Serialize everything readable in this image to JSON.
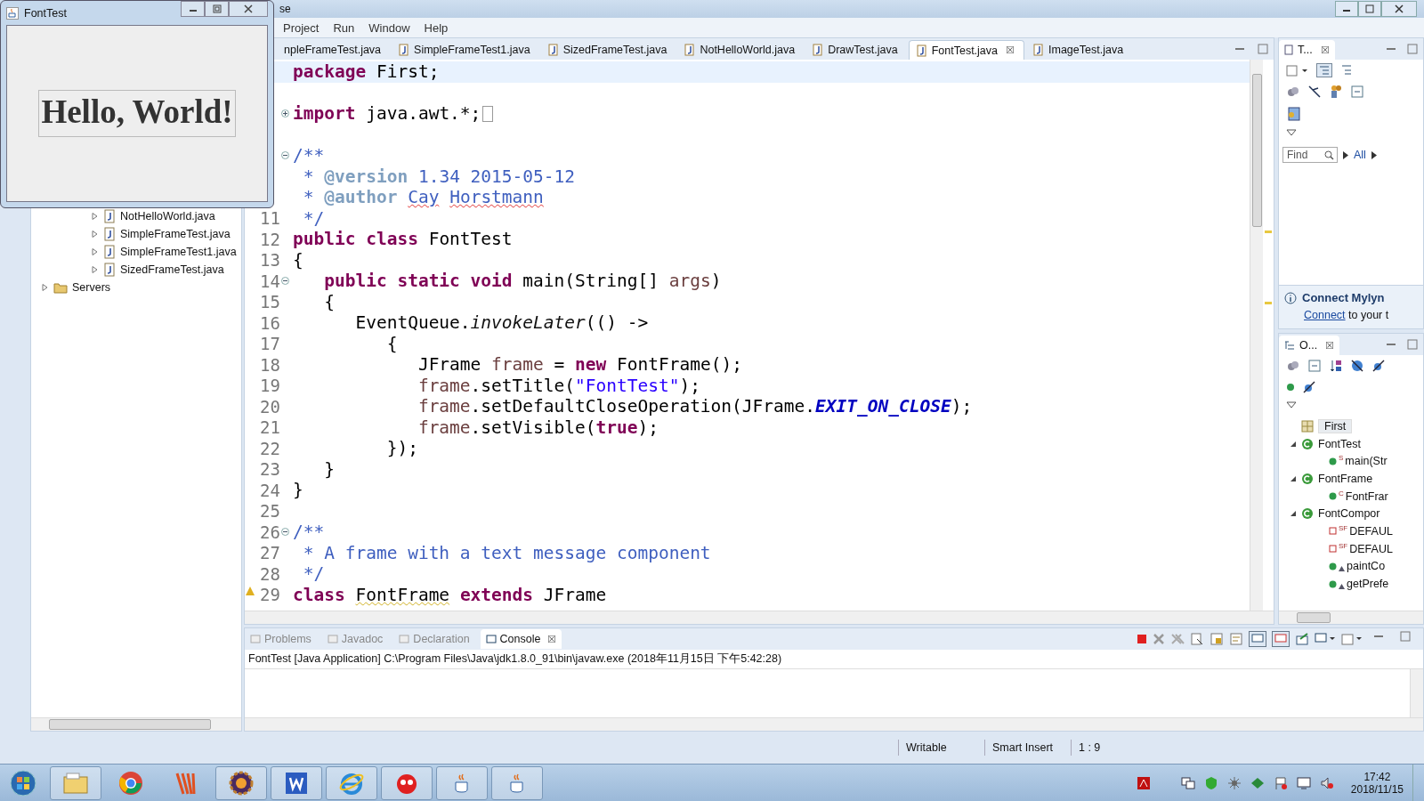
{
  "eclipse_window": {
    "title": "se"
  },
  "menu": [
    "Project",
    "Run",
    "Window",
    "Help"
  ],
  "project_explorer": {
    "items": [
      {
        "label": "NotHelloWorld.java",
        "kind": "java",
        "expanded": false
      },
      {
        "label": "SimpleFrameTest.java",
        "kind": "java",
        "expanded": false
      },
      {
        "label": "SimpleFrameTest1.java",
        "kind": "java",
        "expanded": false
      },
      {
        "label": "SizedFrameTest.java",
        "kind": "java",
        "expanded": false
      },
      {
        "label": "Servers",
        "kind": "folder",
        "expanded": false
      }
    ]
  },
  "editor": {
    "tabs": [
      {
        "label": "npleFrameTest.java",
        "selected": false
      },
      {
        "label": "SimpleFrameTest1.java",
        "selected": false
      },
      {
        "label": "SizedFrameTest.java",
        "selected": false
      },
      {
        "label": "NotHelloWorld.java",
        "selected": false
      },
      {
        "label": "DrawTest.java",
        "selected": false
      },
      {
        "label": "FontTest.java",
        "selected": true,
        "close": "☒"
      },
      {
        "label": "ImageTest.java",
        "selected": false
      }
    ],
    "lines": [
      {
        "current": true,
        "tokens": [
          {
            "kind": "kw",
            "text": "package"
          },
          {
            "kind": "plain",
            "text": " First;"
          }
        ]
      },
      {
        "current": false
      },
      {
        "current": false,
        "folded": true,
        "folded_box": true,
        "tokens": [
          {
            "kind": "kw",
            "text": "import"
          },
          {
            "kind": "plain",
            "text": " java.awt.*;"
          }
        ]
      },
      {
        "current": false
      },
      {
        "current": false,
        "folded": false,
        "tokens": [
          {
            "kind": "javadoc",
            "text": "/**"
          }
        ]
      },
      {
        "current": false,
        "tokens": [
          {
            "kind": "javadoc",
            "text": " * "
          },
          {
            "kind": "jdtag",
            "text": "@version"
          },
          {
            "kind": "javadoc",
            "text": " 1.34 2015-05-12"
          }
        ]
      },
      {
        "current": false,
        "tokens": [
          {
            "kind": "javadoc",
            "text": " * "
          },
          {
            "kind": "jdtag",
            "text": "@author"
          },
          {
            "kind": "javadoc",
            "text": " Cay",
            "misspelled": true
          },
          {
            "kind": "javadoc",
            "text": " Horstmann",
            "misspelled": true
          }
        ]
      },
      {
        "current": false,
        "number": "11",
        "tokens": [
          {
            "kind": "javadoc",
            "text": " */"
          }
        ]
      },
      {
        "current": false,
        "number": "12",
        "tokens": [
          {
            "kind": "kw",
            "text": "public class"
          },
          {
            "kind": "plain",
            "text": " FontTest"
          }
        ]
      },
      {
        "current": false,
        "number": "13",
        "tokens": [
          {
            "kind": "plain",
            "text": "{"
          }
        ]
      },
      {
        "current": false,
        "number": "14",
        "folded": false,
        "tokens": [
          {
            "kind": "kw",
            "text": "   public static void"
          },
          {
            "kind": "plain",
            "text": " main(String[] "
          },
          {
            "kind": "local",
            "text": "args"
          },
          {
            "kind": "plain",
            "text": ")"
          }
        ]
      },
      {
        "current": false,
        "number": "15",
        "tokens": [
          {
            "kind": "plain",
            "text": "   {"
          }
        ]
      },
      {
        "current": false,
        "number": "16",
        "tokens": [
          {
            "kind": "plain",
            "text": "      EventQueue."
          },
          {
            "kind": "static",
            "text": "invokeLater"
          },
          {
            "kind": "plain",
            "text": "(() ->"
          }
        ]
      },
      {
        "current": false,
        "number": "17",
        "tokens": [
          {
            "kind": "plain",
            "text": "         {"
          }
        ]
      },
      {
        "current": false,
        "number": "18",
        "tokens": [
          {
            "kind": "plain",
            "text": "            JFrame "
          },
          {
            "kind": "local",
            "text": "frame"
          },
          {
            "kind": "plain",
            "text": " = "
          },
          {
            "kind": "kw",
            "text": "new"
          },
          {
            "kind": "plain",
            "text": " FontFrame();"
          }
        ]
      },
      {
        "current": false,
        "number": "19",
        "tokens": [
          {
            "kind": "local",
            "text": "            frame"
          },
          {
            "kind": "plain",
            "text": ".setTitle("
          },
          {
            "kind": "string",
            "text": "\"FontTest\""
          },
          {
            "kind": "plain",
            "text": ");"
          }
        ]
      },
      {
        "current": false,
        "number": "20",
        "tokens": [
          {
            "kind": "local",
            "text": "            frame"
          },
          {
            "kind": "plain",
            "text": ".setDefaultCloseOperation(JFrame."
          },
          {
            "kind": "const",
            "text": "EXIT_ON_CLOSE"
          },
          {
            "kind": "plain",
            "text": ");"
          }
        ]
      },
      {
        "current": false,
        "number": "21",
        "tokens": [
          {
            "kind": "local",
            "text": "            frame"
          },
          {
            "kind": "plain",
            "text": ".setVisible("
          },
          {
            "kind": "kw",
            "text": "true"
          },
          {
            "kind": "plain",
            "text": ");"
          }
        ]
      },
      {
        "current": false,
        "number": "22",
        "tokens": [
          {
            "kind": "plain",
            "text": "         });"
          }
        ]
      },
      {
        "current": false,
        "number": "23",
        "tokens": [
          {
            "kind": "plain",
            "text": "   }"
          }
        ]
      },
      {
        "current": false,
        "number": "24",
        "tokens": [
          {
            "kind": "plain",
            "text": "}"
          }
        ]
      },
      {
        "current": false,
        "number": "25"
      },
      {
        "current": false,
        "number": "26",
        "folded": false,
        "tokens": [
          {
            "kind": "javadoc",
            "text": "/**"
          }
        ]
      },
      {
        "current": false,
        "number": "27",
        "tokens": [
          {
            "kind": "javadoc",
            "text": " * A frame with a text message component"
          }
        ]
      },
      {
        "current": false,
        "number": "28",
        "tokens": [
          {
            "kind": "javadoc",
            "text": " */"
          }
        ]
      },
      {
        "current": false,
        "number": "29",
        "warning": true,
        "tokens": [
          {
            "kind": "kw",
            "text": "class"
          },
          {
            "kind": "plain",
            "text": " FontFrame",
            "flagged": true
          },
          {
            "kind": "kw",
            "text": " extends"
          },
          {
            "kind": "plain",
            "text": " JFrame"
          }
        ]
      }
    ]
  },
  "task_list": {
    "tab": "T...",
    "close": "☒",
    "find_placeholder": "Find",
    "filter": "All",
    "mylyn_title": "Connect Mylyn",
    "mylyn_link": "Connect",
    "mylyn_text": " to your t"
  },
  "outline": {
    "tab": "O...",
    "close": "☒",
    "items": [
      {
        "label": "First",
        "kind": "package"
      },
      {
        "label": "FontTest",
        "kind": "class",
        "expanded": true,
        "children": [
          {
            "label": "main(Str",
            "kind": "method",
            "badge": "S"
          }
        ]
      },
      {
        "label": "FontFrame",
        "kind": "class",
        "expanded": true,
        "children": [
          {
            "label": "FontFrar",
            "kind": "method",
            "badge": "C"
          }
        ]
      },
      {
        "label": "FontCompor",
        "kind": "class",
        "expanded": true,
        "children": [
          {
            "label": "DEFAUL",
            "kind": "field",
            "badge": "SF"
          },
          {
            "label": "DEFAUL",
            "kind": "field",
            "badge": "SF"
          },
          {
            "label": "paintCo",
            "kind": "method"
          },
          {
            "label": "getPrefe",
            "kind": "method"
          }
        ]
      }
    ]
  },
  "console": {
    "tabs": [
      {
        "label": "Problems",
        "selected": false
      },
      {
        "label": "Javadoc",
        "selected": false
      },
      {
        "label": "Declaration",
        "selected": false
      },
      {
        "label": "Console",
        "selected": true,
        "close": "☒"
      }
    ],
    "header": "FontTest [Java Application] C:\\Program Files\\Java\\jdk1.8.0_91\\bin\\javaw.exe (2018年11月15日 下午5:42:28)"
  },
  "status_bar": [
    "Writable",
    "Smart Insert",
    "1 : 9"
  ],
  "taskbar": {
    "time": "17:42",
    "date": "2018/11/15"
  },
  "font_test_window": {
    "title": "FontTest",
    "message": "Hello, World!"
  }
}
